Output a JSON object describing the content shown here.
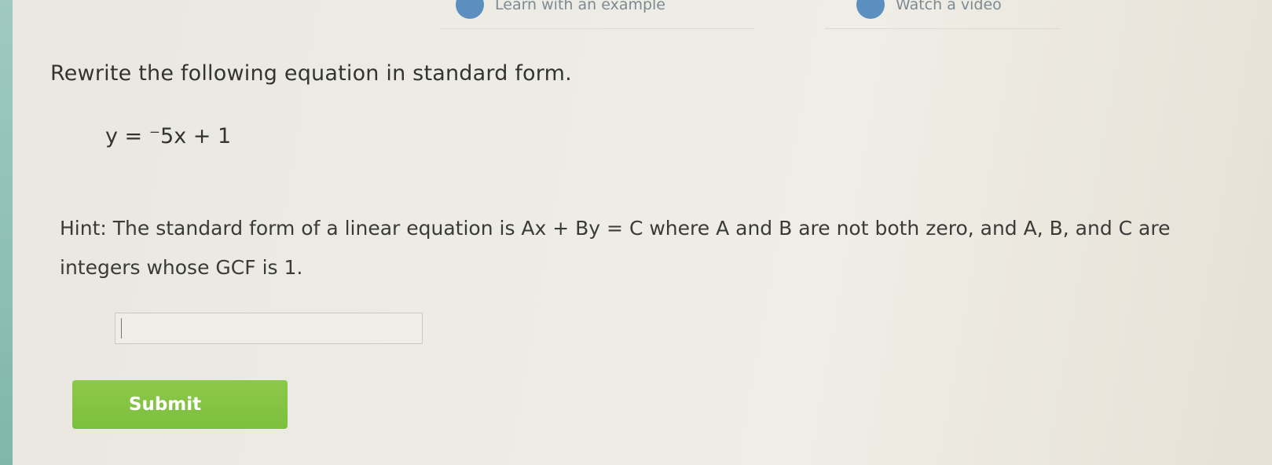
{
  "header": {
    "links": [
      {
        "label": "Learn with an example",
        "icon": "lightbulb-icon"
      },
      {
        "label": "Watch a video",
        "icon": "play-icon"
      }
    ]
  },
  "question": {
    "prompt": "Rewrite the following equation in standard form.",
    "equation": "y = ⁻5x + 1",
    "hint": "Hint: The standard form of a linear equation is Ax + By = C where A and B are not both zero, and A, B, and C are integers whose GCF is 1."
  },
  "answer": {
    "value": "",
    "placeholder": ""
  },
  "actions": {
    "submit_label": "Submit"
  },
  "colors": {
    "submit_button": "#7cbf3f",
    "left_strip": "#8dbfb6",
    "icon_badge": "#5b8fbf"
  }
}
